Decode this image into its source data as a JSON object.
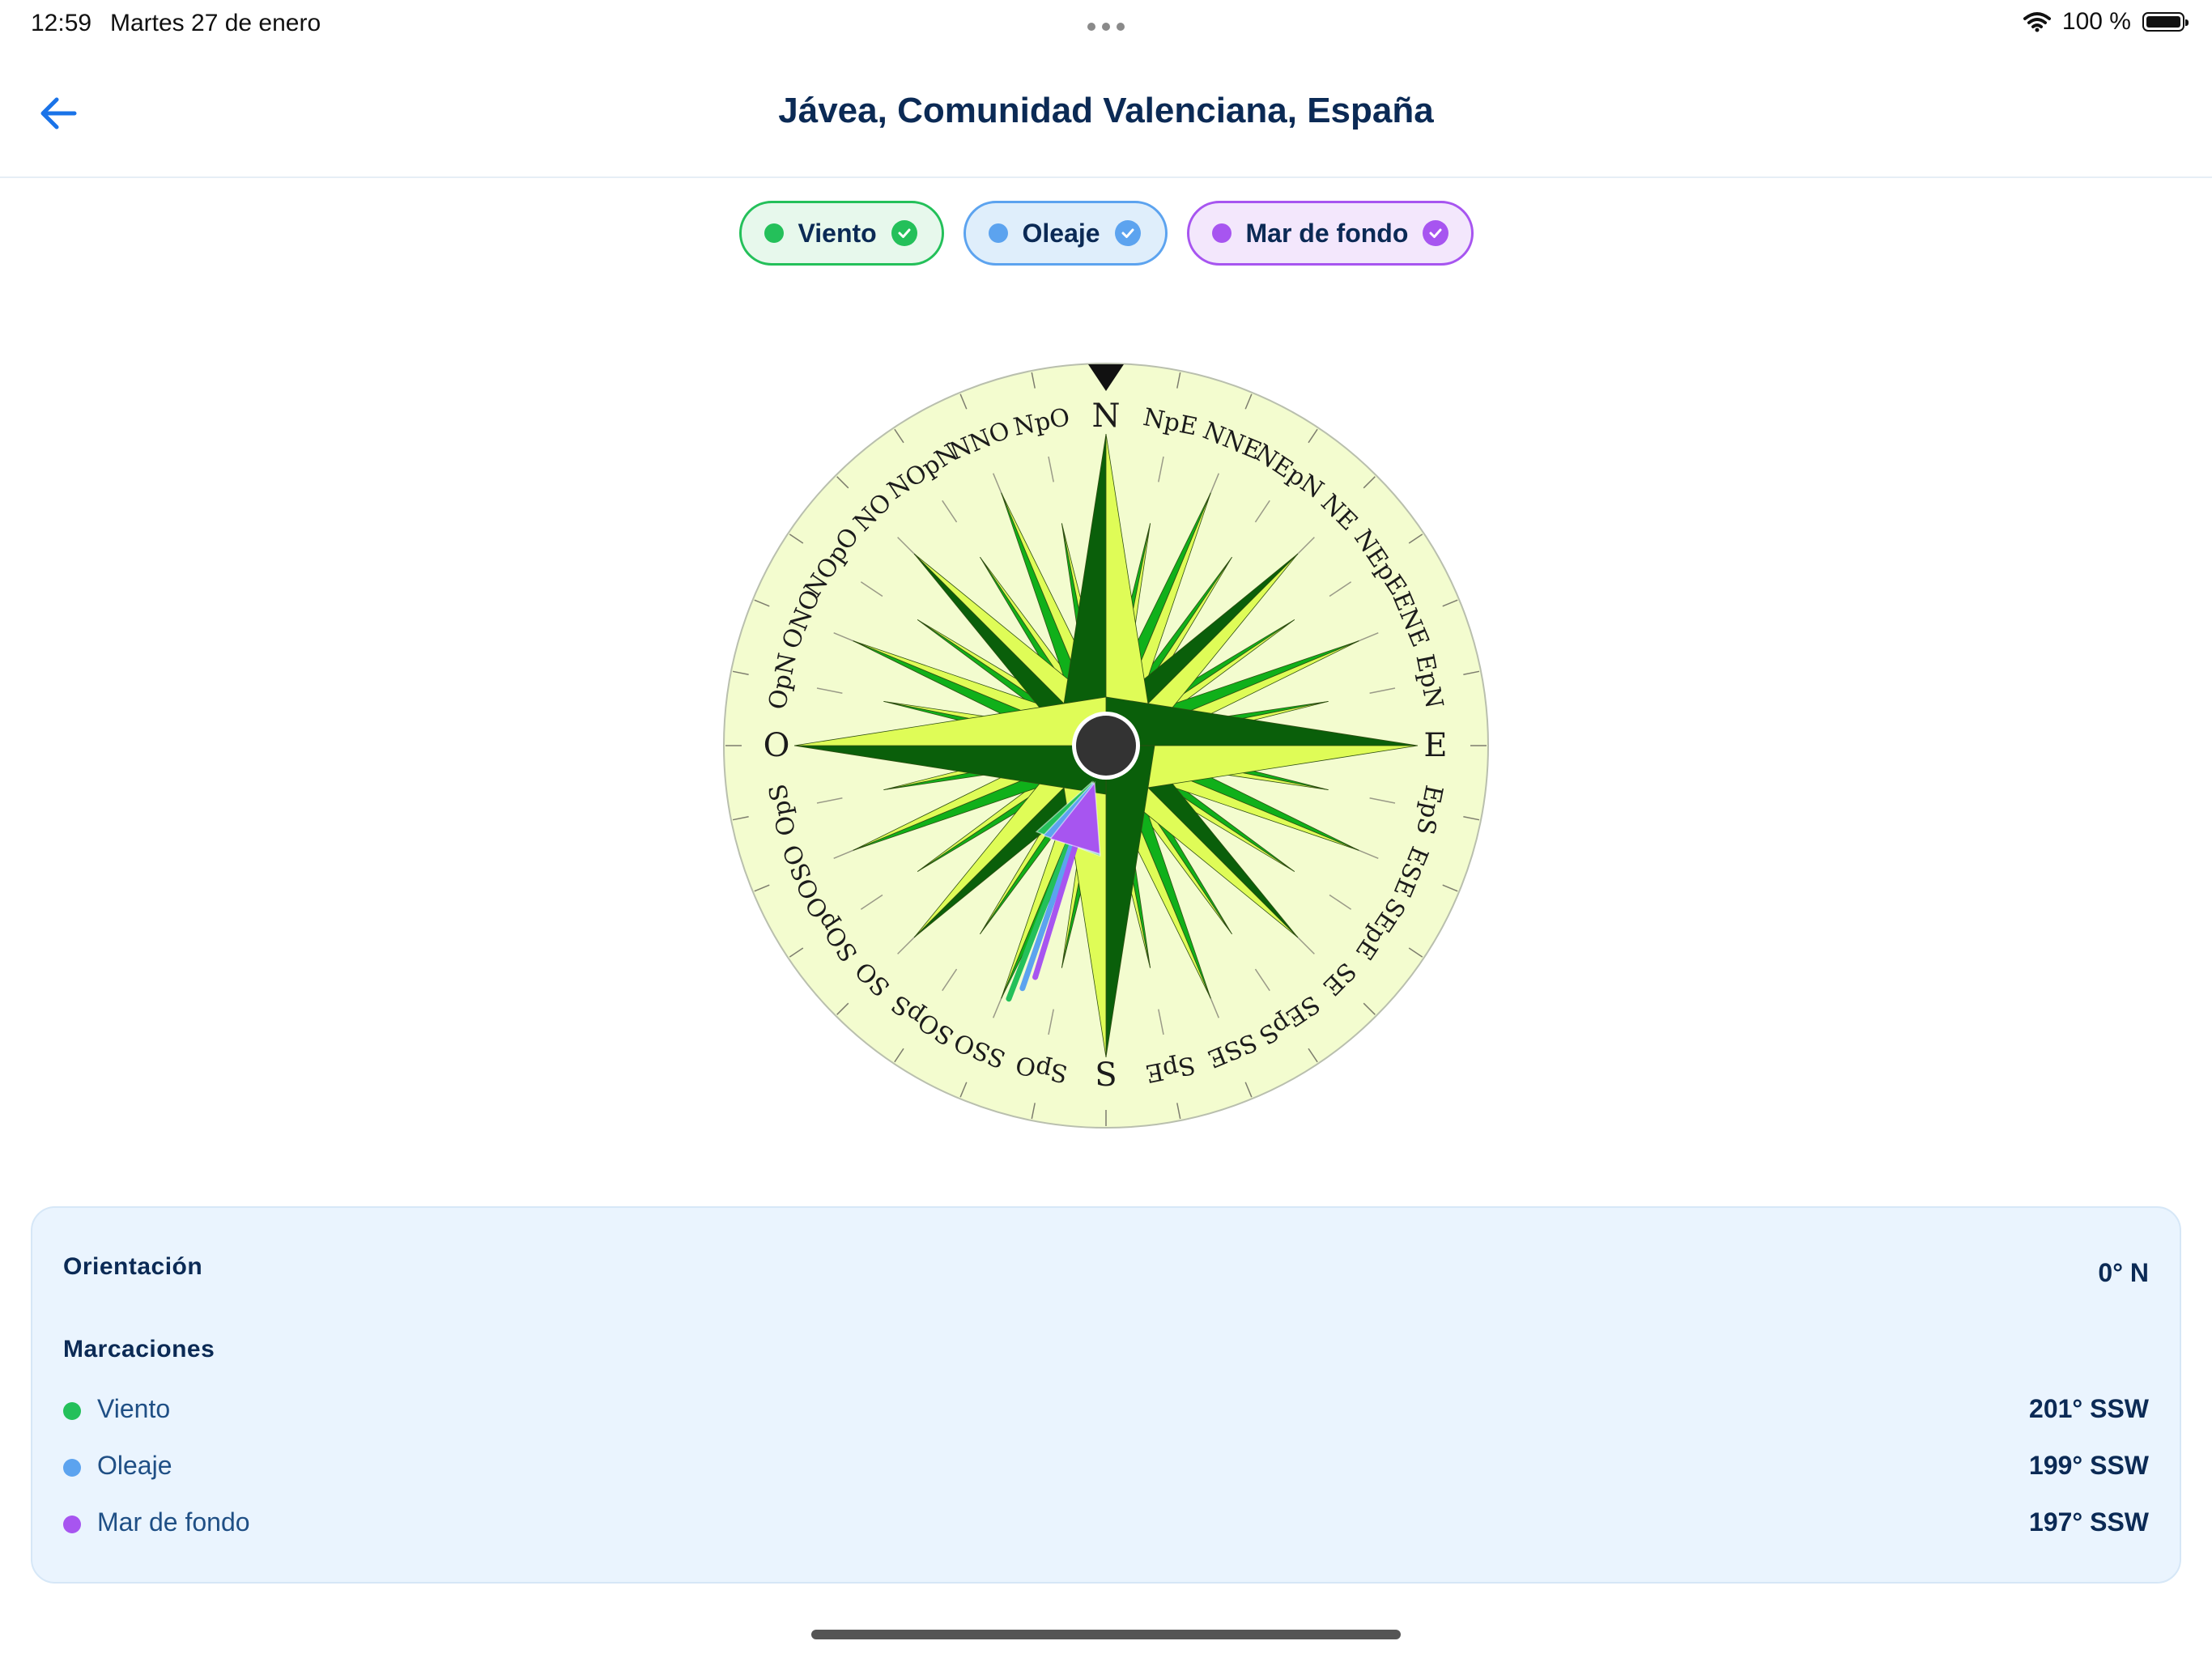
{
  "status_bar": {
    "time": "12:59",
    "date": "Martes 27 de enero",
    "battery": "100 %"
  },
  "header": {
    "title": "Jávea, Comunidad Valenciana, España",
    "back_icon": "arrow-left-icon"
  },
  "colors": {
    "wind": "#24c05a",
    "waves": "#5ca3ef",
    "swell": "#a755f0",
    "rose_dark": "#0a5f0a",
    "rose_mid": "#10b01a",
    "rose_light": "#dffc57",
    "dial_bg": "#f3fccf"
  },
  "chips": [
    {
      "label": "Viento",
      "color": "#24c05a"
    },
    {
      "label": "Oleaje",
      "color": "#5ca3ef"
    },
    {
      "label": "Mar de fondo",
      "color": "#a755f0"
    }
  ],
  "compass": {
    "labels": [
      "N",
      "NpE",
      "NNE",
      "NEpN",
      "NE",
      "NEpE",
      "ENE",
      "EpN",
      "E",
      "EpS",
      "ESE",
      "SEpE",
      "SE",
      "SEpS",
      "SSE",
      "SpE",
      "S",
      "SpO",
      "SSO",
      "SOpS",
      "SO",
      "SOpO",
      "OSO",
      "OpS",
      "O",
      "OpN",
      "ONO",
      "NOpO",
      "NO",
      "NOpN",
      "NNO",
      "NpO"
    ],
    "orientation_deg": 0,
    "markers": [
      {
        "name": "Viento",
        "deg": 201,
        "color": "#24c05a"
      },
      {
        "name": "Oleaje",
        "deg": 199,
        "color": "#5ca3ef"
      },
      {
        "name": "Mar de fondo",
        "deg": 197,
        "color": "#a755f0"
      }
    ]
  },
  "info": {
    "orientation_label": "Orientación",
    "orientation_value": "0° N",
    "markings_label": "Marcaciones",
    "rows": [
      {
        "name": "Viento",
        "value": "201° SSW"
      },
      {
        "name": "Oleaje",
        "value": "199° SSW"
      },
      {
        "name": "Mar de fondo",
        "value": "197° SSW"
      }
    ]
  }
}
